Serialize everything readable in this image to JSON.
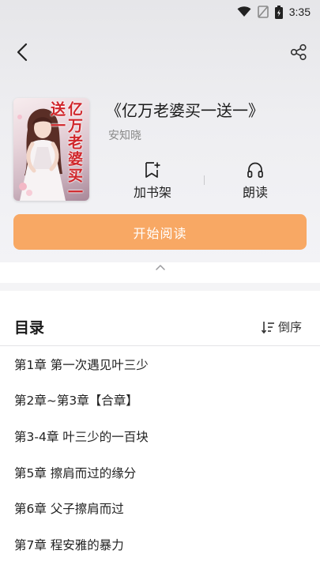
{
  "status_bar": {
    "time": "3:35",
    "icons": [
      "wifi-icon",
      "no-signal-icon",
      "battery-icon"
    ]
  },
  "nav": {
    "back_icon": "back-arrow-icon",
    "share_icon": "share-icon"
  },
  "book": {
    "title": "《亿万老婆买一送一》",
    "author": "安知晓",
    "cover_text": "亿万老婆买一送一"
  },
  "actions": {
    "add_shelf_label": "加书架",
    "listen_label": "朗读"
  },
  "start_button": {
    "label": "开始阅读"
  },
  "toc": {
    "title": "目录",
    "sort_label": "倒序",
    "chapters": [
      "第1章 第一次遇见叶三少",
      "第2章~第3章【合章】",
      "第3-4章 叶三少的一百块",
      "第5章 擦肩而过的缘分",
      "第6章 父子擦肩而过",
      "第7章 程安雅的暴力"
    ]
  },
  "colors": {
    "accent": "#f8a864",
    "cover_title": "#d0262b"
  }
}
